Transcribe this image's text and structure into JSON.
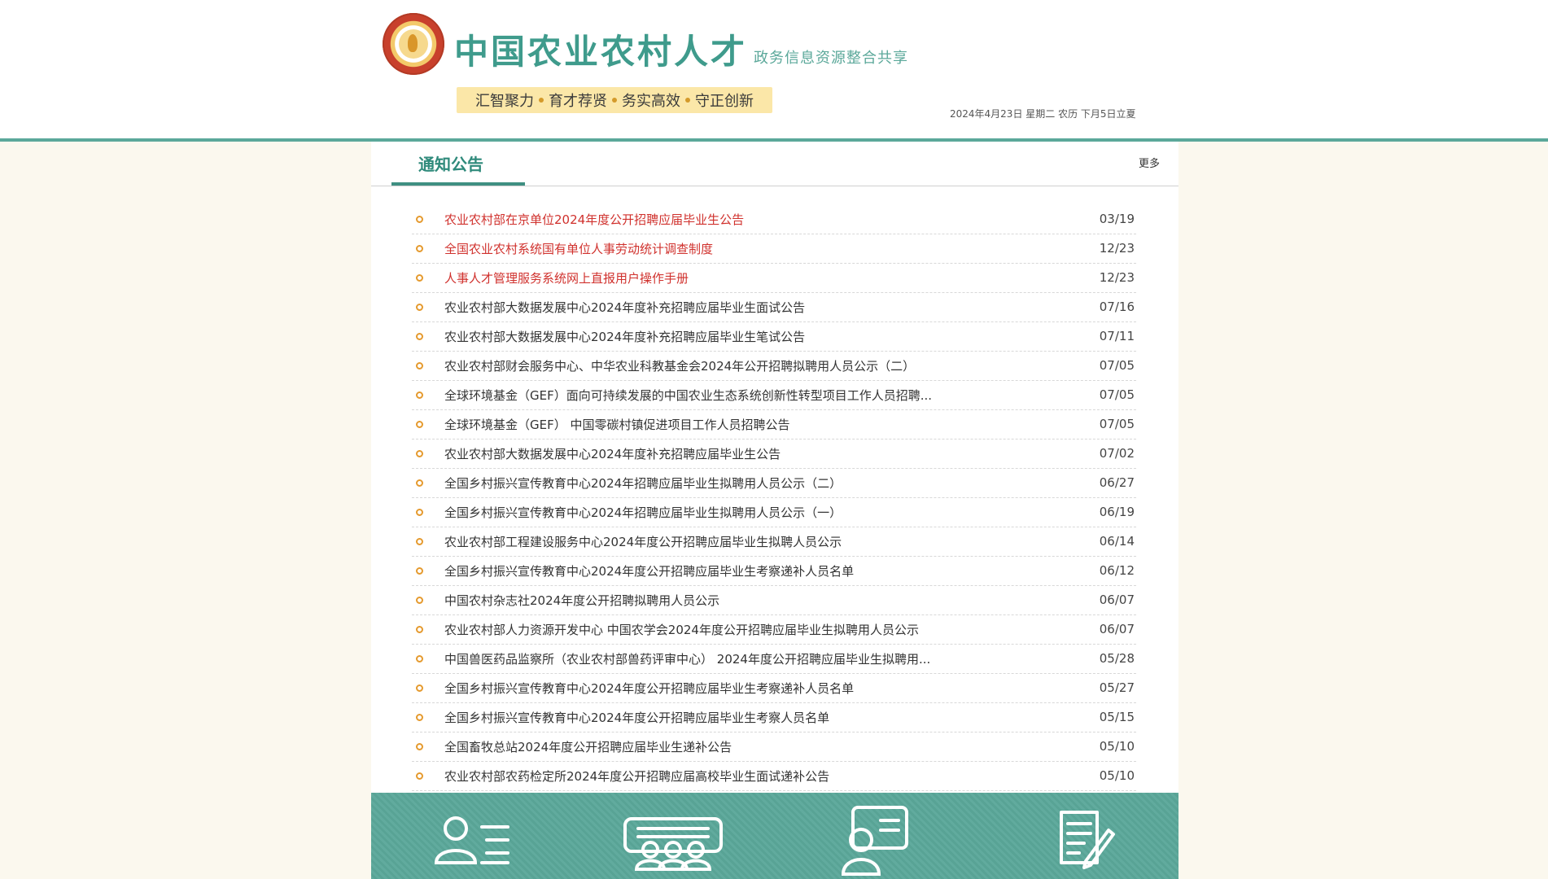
{
  "header": {
    "site_title": "中国农业农村人才",
    "site_subtitle": "政务信息资源整合共享",
    "slogans": [
      "汇智聚力",
      "育才荐贤",
      "务实高效",
      "守正创新"
    ],
    "date_line": "2024年4月23日 星期二 农历 下月5日立夏"
  },
  "notice": {
    "title": "通知公告",
    "more_label": "更多",
    "items": [
      {
        "title": "农业农村部在京单位2024年度公开招聘应届毕业生公告",
        "date": "03/19",
        "highlight": true
      },
      {
        "title": "全国农业农村系统国有单位人事劳动统计调查制度",
        "date": "12/23",
        "highlight": true
      },
      {
        "title": "人事人才管理服务系统网上直报用户操作手册",
        "date": "12/23",
        "highlight": true
      },
      {
        "title": "农业农村部大数据发展中心2024年度补充招聘应届毕业生面试公告",
        "date": "07/16",
        "highlight": false
      },
      {
        "title": "农业农村部大数据发展中心2024年度补充招聘应届毕业生笔试公告",
        "date": "07/11",
        "highlight": false
      },
      {
        "title": "农业农村部财会服务中心、中华农业科教基金会2024年公开招聘拟聘用人员公示（二）",
        "date": "07/05",
        "highlight": false
      },
      {
        "title": "全球环境基金（GEF）面向可持续发展的中国农业生态系统创新性转型项目工作人员招聘...",
        "date": "07/05",
        "highlight": false
      },
      {
        "title": "全球环境基金（GEF） 中国零碳村镇促进项目工作人员招聘公告",
        "date": "07/05",
        "highlight": false
      },
      {
        "title": "农业农村部大数据发展中心2024年度补充招聘应届毕业生公告",
        "date": "07/02",
        "highlight": false
      },
      {
        "title": "全国乡村振兴宣传教育中心2024年招聘应届毕业生拟聘用人员公示（二）",
        "date": "06/27",
        "highlight": false
      },
      {
        "title": "全国乡村振兴宣传教育中心2024年招聘应届毕业生拟聘用人员公示（一）",
        "date": "06/19",
        "highlight": false
      },
      {
        "title": "农业农村部工程建设服务中心2024年度公开招聘应届毕业生拟聘人员公示",
        "date": "06/14",
        "highlight": false
      },
      {
        "title": "全国乡村振兴宣传教育中心2024年度公开招聘应届毕业生考察递补人员名单",
        "date": "06/12",
        "highlight": false
      },
      {
        "title": "中国农村杂志社2024年度公开招聘拟聘用人员公示",
        "date": "06/07",
        "highlight": false
      },
      {
        "title": "农业农村部人力资源开发中心 中国农学会2024年度公开招聘应届毕业生拟聘用人员公示",
        "date": "06/07",
        "highlight": false
      },
      {
        "title": "中国兽医药品监察所（农业农村部兽药评审中心） 2024年度公开招聘应届毕业生拟聘用...",
        "date": "05/28",
        "highlight": false
      },
      {
        "title": "全国乡村振兴宣传教育中心2024年度公开招聘应届毕业生考察递补人员名单",
        "date": "05/27",
        "highlight": false
      },
      {
        "title": "全国乡村振兴宣传教育中心2024年度公开招聘应届毕业生考察人员名单",
        "date": "05/15",
        "highlight": false
      },
      {
        "title": "全国畜牧总站2024年度公开招聘应届毕业生递补公告",
        "date": "05/10",
        "highlight": false
      },
      {
        "title": "农业农村部农药检定所2024年度公开招聘应届高校毕业生面试递补公告",
        "date": "05/10",
        "highlight": false
      }
    ]
  },
  "quick_links": [
    {
      "icon": "person-list-icon"
    },
    {
      "icon": "group-board-icon"
    },
    {
      "icon": "id-card-icon"
    },
    {
      "icon": "document-edit-icon"
    }
  ],
  "colors": {
    "brand": "#3f9b8c",
    "highlight": "#d0312d",
    "bullet": "#e59a2e",
    "quick_bar": "#5ba89a"
  }
}
